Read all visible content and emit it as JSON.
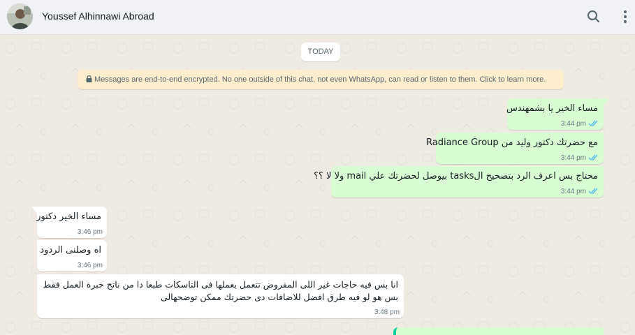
{
  "header": {
    "contact_name": "Youssef Alhinnawi Abroad",
    "search_icon": "search-icon",
    "menu_icon": "more-vertical-icon"
  },
  "chat": {
    "date_label": "TODAY",
    "encryption_notice": "Messages are end-to-end encrypted. No one outside of this chat, not even WhatsApp, can read or listen to them. Click to learn more.",
    "messages": [
      {
        "direction": "out",
        "text": "مساء الخير يا بشمهندس",
        "time": "3:44 pm",
        "status": "read"
      },
      {
        "direction": "out",
        "text": "مع حضرتك دكتور وليد من Radiance Group",
        "time": "3:44 pm",
        "status": "read"
      },
      {
        "direction": "out",
        "text": "محتاج بس اعرف الرد بتصحيح الtasks بيوصل لحضرتك علي mail ولا لا ؟؟",
        "time": "3:44 pm",
        "status": "read"
      },
      {
        "direction": "in",
        "text": "مساء الخير دكتور",
        "time": "3:46 pm"
      },
      {
        "direction": "in",
        "text": "اه وصلنى الردود",
        "time": "3:46 pm"
      },
      {
        "direction": "in",
        "text_line1": "انا بس فيه حاجات غير اللى المفروض تتعمل بعملها فى التاسكات طبعا دا من ناتج خبرة العمل فقط",
        "text_line2": "بس هو لو فيه طرق افضل للاضافات دى حضرتك ممكن توضحهالى",
        "time": "3:48 pm"
      }
    ]
  },
  "colors": {
    "chat_background": "#efeae2",
    "outgoing_bubble": "#d9fdd3",
    "incoming_bubble": "#ffffff",
    "read_ticks": "#53bdeb",
    "encryption_banner": "#ffeecd"
  }
}
